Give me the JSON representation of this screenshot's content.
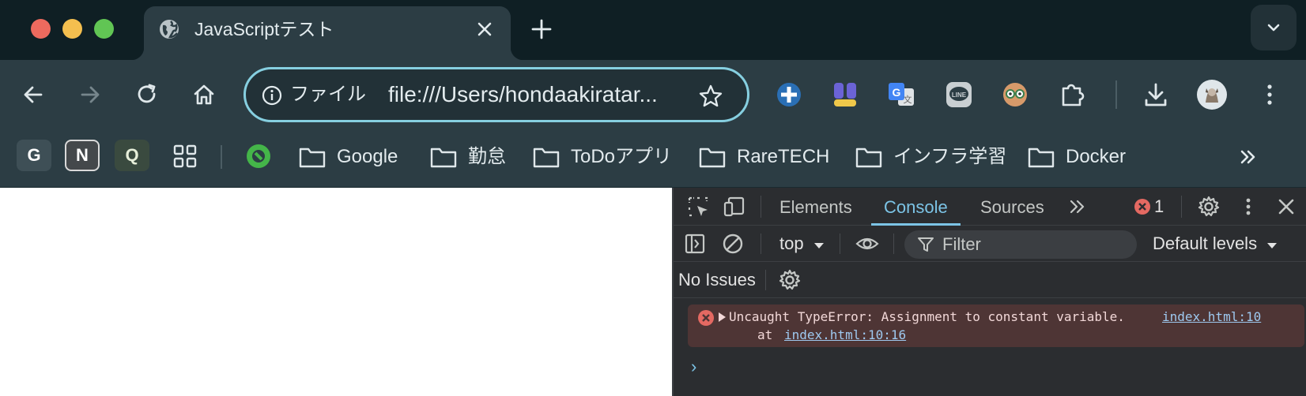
{
  "tab": {
    "title": "JavaScriptテスト"
  },
  "omnibox": {
    "scheme_label": "ファイル",
    "url": "file:///Users/hondaakiratar..."
  },
  "bookmarks": {
    "apps": [
      "G",
      "N",
      "Q"
    ],
    "folders": [
      "Google",
      "勤怠",
      "ToDoアプリ",
      "RareTECH",
      "インフラ学習",
      "Docker"
    ]
  },
  "devtools": {
    "tabs": [
      "Elements",
      "Console",
      "Sources"
    ],
    "active_tab": "Console",
    "error_count": "1",
    "context": "top",
    "filter_placeholder": "Filter",
    "levels": "Default levels",
    "issues": "No Issues",
    "error": {
      "message": "Uncaught TypeError: Assignment to constant variable.",
      "source": "index.html:10",
      "at_label": "at",
      "stack_link": "index.html:10:16"
    },
    "prompt": "›"
  },
  "colors": {
    "accent": "#7cc4e6",
    "error_bg": "#4e3535",
    "error_icon": "#e46962"
  }
}
